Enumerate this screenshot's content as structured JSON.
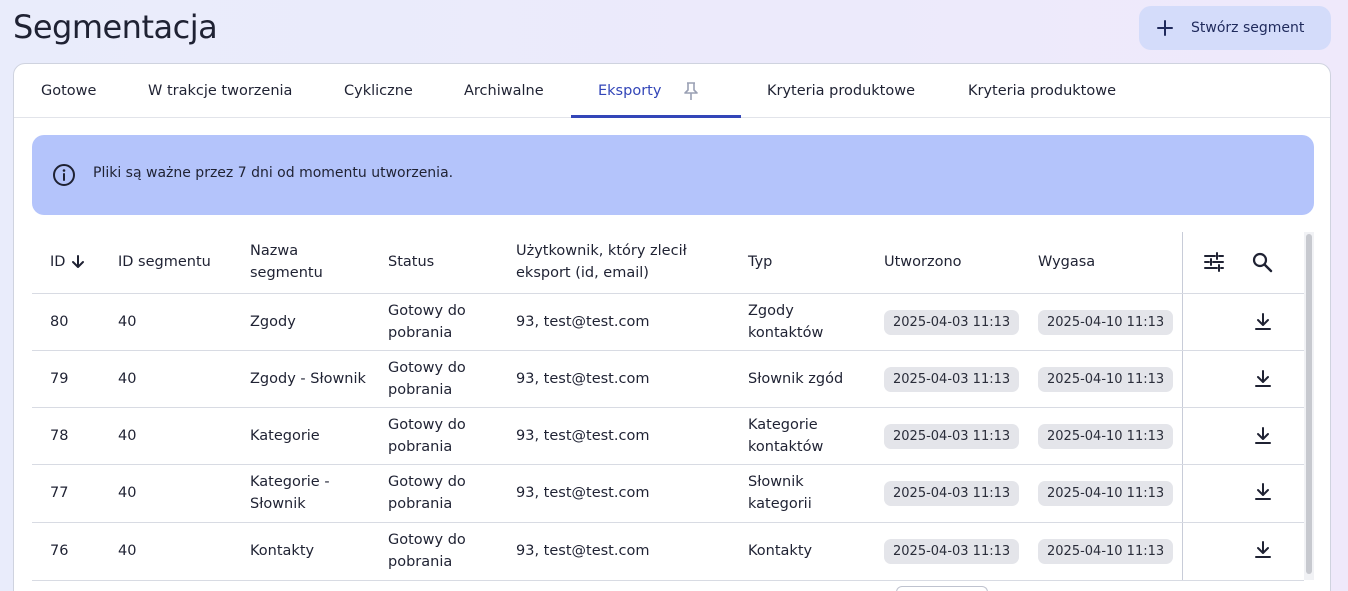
{
  "page": {
    "title": "Segmentacja"
  },
  "header": {
    "create_label": "Stwórz segment",
    "create_icon": "plus-icon"
  },
  "tabs": [
    {
      "label": "Gotowe"
    },
    {
      "label": "W trakcje tworzenia"
    },
    {
      "label": "Cykliczne"
    },
    {
      "label": "Archiwalne"
    },
    {
      "label": "Eksporty",
      "active": true,
      "icon": "pin-icon"
    },
    {
      "label": "Kryteria produktowe"
    },
    {
      "label": "Kryteria produktowe"
    }
  ],
  "info": {
    "text": "Pliki są ważne przez 7 dni od momentu utworzenia.",
    "icon": "info-icon"
  },
  "table": {
    "columns": {
      "id": "ID",
      "segment_id": "ID segmentu",
      "name_1": "Nazwa",
      "name_2": "segmentu",
      "status": "Status",
      "user_1": "Użytkownik, który zlecił",
      "user_2": "eksport (id, email)",
      "type": "Typ",
      "created": "Utworzono",
      "expires": "Wygasa"
    },
    "rows": [
      {
        "id": "80",
        "segment_id": "40",
        "name": [
          "Zgody"
        ],
        "status": [
          "Gotowy do",
          "pobrania"
        ],
        "user": "93, test@test.com",
        "type": [
          "Zgody",
          "kontaktów"
        ],
        "created": "2025-04-03 11:13",
        "expires": "2025-04-10 11:13"
      },
      {
        "id": "79",
        "segment_id": "40",
        "name": [
          "Zgody - Słownik"
        ],
        "status": [
          "Gotowy do",
          "pobrania"
        ],
        "user": "93, test@test.com",
        "type": [
          "Słownik zgód"
        ],
        "created": "2025-04-03 11:13",
        "expires": "2025-04-10 11:13"
      },
      {
        "id": "78",
        "segment_id": "40",
        "name": [
          "Kategorie"
        ],
        "status": [
          "Gotowy do",
          "pobrania"
        ],
        "user": "93, test@test.com",
        "type": [
          "Kategorie",
          "kontaktów"
        ],
        "created": "2025-04-03 11:13",
        "expires": "2025-04-10 11:13"
      },
      {
        "id": "77",
        "segment_id": "40",
        "name": [
          "Kategorie -",
          "Słownik"
        ],
        "status": [
          "Gotowy do",
          "pobrania"
        ],
        "user": "93, test@test.com",
        "type": [
          "Słownik",
          "kategorii"
        ],
        "created": "2025-04-03 11:13",
        "expires": "2025-04-10 11:13"
      },
      {
        "id": "76",
        "segment_id": "40",
        "name": [
          "Kontakty"
        ],
        "status": [
          "Gotowy do",
          "pobrania"
        ],
        "user": "93, test@test.com",
        "type": [
          "Kontakty"
        ],
        "created": "2025-04-03 11:13",
        "expires": "2025-04-10 11:13"
      }
    ]
  },
  "colors": {
    "accent": "#3346b8",
    "banner": "#b4c4fb",
    "button_bg": "#d4dcfa",
    "chip_bg": "#e4e5ea"
  }
}
